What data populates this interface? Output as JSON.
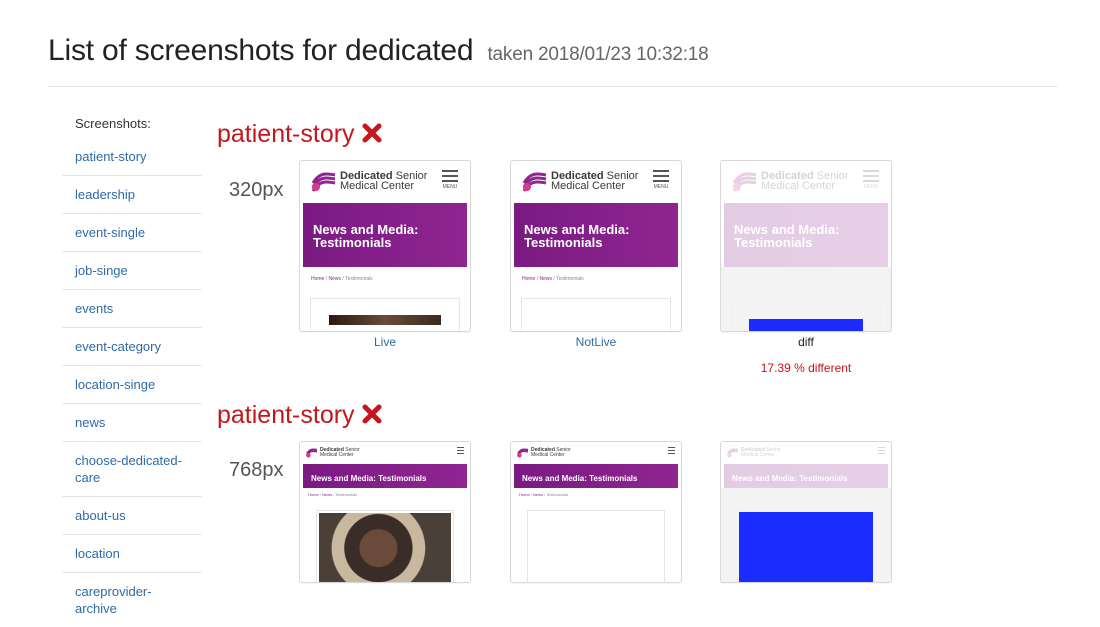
{
  "header": {
    "title": "List of screenshots for dedicated",
    "taken": "taken 2018/01/23 10:32:18"
  },
  "sidebar": {
    "title": "Screenshots:",
    "items": [
      {
        "label": "patient-story"
      },
      {
        "label": "leadership"
      },
      {
        "label": "event-single"
      },
      {
        "label": "job-singe"
      },
      {
        "label": "events"
      },
      {
        "label": "event-category"
      },
      {
        "label": "location-singe"
      },
      {
        "label": "news"
      },
      {
        "label": "choose-dedicated-care"
      },
      {
        "label": "about-us"
      },
      {
        "label": "location"
      },
      {
        "label": "careprovider-archive"
      }
    ]
  },
  "sections": [
    {
      "title": "patient-story",
      "status_icon": "x-icon",
      "size": "320px",
      "thumbnail": {
        "brand_bold": "Dedicated",
        "brand_rest": "Senior",
        "brand_line2": "Medical Center",
        "menu_text": "MENU",
        "banner_line1": "News and Media:",
        "banner_line2": "Testimonials",
        "crumb_home": "Home",
        "crumb_news": "News",
        "crumb_current": "Testimonials"
      },
      "labels": {
        "live": "Live",
        "notlive": "NotLive",
        "diff": "diff"
      },
      "percent_diff": "17.39 % different"
    },
    {
      "title": "patient-story",
      "status_icon": "x-icon",
      "size": "768px",
      "thumbnail": {
        "brand_bold": "Dedicated",
        "brand_rest": "Senior",
        "brand_line2": "Medical Center",
        "banner": "News and Media: Testimonials",
        "crumb_home": "Home",
        "crumb_news": "News",
        "crumb_current": "Testimonials"
      }
    }
  ],
  "colors": {
    "fail": "#c4161c",
    "link": "#2f6aa8",
    "brand": "#8f2590",
    "diff_highlight": "#1a2cff"
  }
}
